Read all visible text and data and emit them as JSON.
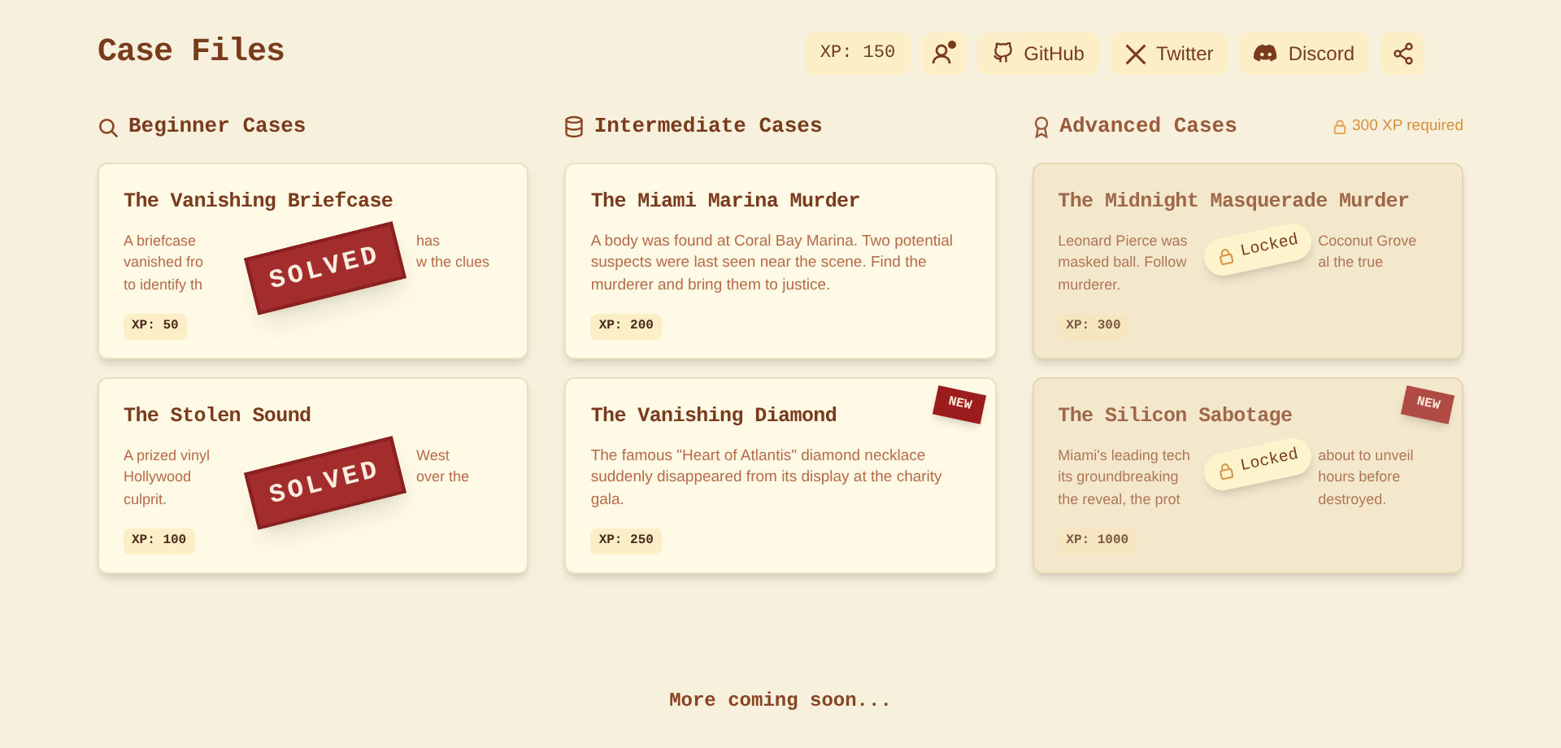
{
  "header": {
    "title": "Case Files",
    "xp": "XP: 150",
    "links": [
      {
        "kind": "profile",
        "notification": true
      },
      {
        "kind": "github",
        "label": "GitHub"
      },
      {
        "kind": "twitter",
        "label": "Twitter"
      },
      {
        "kind": "discord",
        "label": "Discord"
      },
      {
        "kind": "share"
      }
    ]
  },
  "sections": [
    {
      "title": "Beginner Cases",
      "cases": [
        {
          "title": "The Vanishing Briefcase",
          "solved": true,
          "locked": false,
          "badge": "SOLVED",
          "description_lines": [
            [
              "A briefcase",
              "has"
            ],
            [
              "vanished fro",
              "w the clues"
            ],
            [
              "to identify th"
            ]
          ],
          "xp": "XP: 50"
        },
        {
          "title": "The Stolen Sound",
          "solved": true,
          "locked": false,
          "badge": "SOLVED",
          "description_lines": [
            [
              "A prized vinyl",
              "West"
            ],
            [
              "Hollywood",
              "over the"
            ],
            [
              "culprit."
            ]
          ],
          "xp": "XP: 100"
        }
      ]
    },
    {
      "title": "Intermediate Cases",
      "cases": [
        {
          "title": "The Miami Marina Murder",
          "solved": false,
          "locked": false,
          "description": "A body was found at Coral Bay Marina. Two potential suspects were last seen near the scene. Find the murderer and bring them to justice.",
          "xp": "XP: 200"
        },
        {
          "title": "The Vanishing Diamond",
          "solved": false,
          "locked": false,
          "new_badge": "NEW",
          "description": "The famous \"Heart of Atlantis\" diamond necklace suddenly disappeared from its display at the charity gala.",
          "xp": "XP: 250"
        }
      ]
    },
    {
      "title": "Advanced Cases",
      "requirement": "300 XP required",
      "cases": [
        {
          "title": "The Midnight Masquerade Murder",
          "solved": false,
          "locked": true,
          "badge": "Locked",
          "description_lines": [
            [
              "Leonard Pierce was",
              "Coconut Grove"
            ],
            [
              "masked ball. Follow",
              "al the true"
            ],
            [
              "murderer."
            ]
          ],
          "xp": "XP: 300"
        },
        {
          "title": "The Silicon Sabotage",
          "solved": false,
          "locked": true,
          "badge": "Locked",
          "new_badge": "NEW",
          "description_lines": [
            [
              "Miami's leading tech",
              "about to unveil"
            ],
            [
              "its groundbreaking",
              "hours before"
            ],
            [
              "the reveal, the prot",
              "destroyed."
            ]
          ],
          "xp": "XP: 1000"
        }
      ]
    }
  ],
  "footer": "More coming soon..."
}
